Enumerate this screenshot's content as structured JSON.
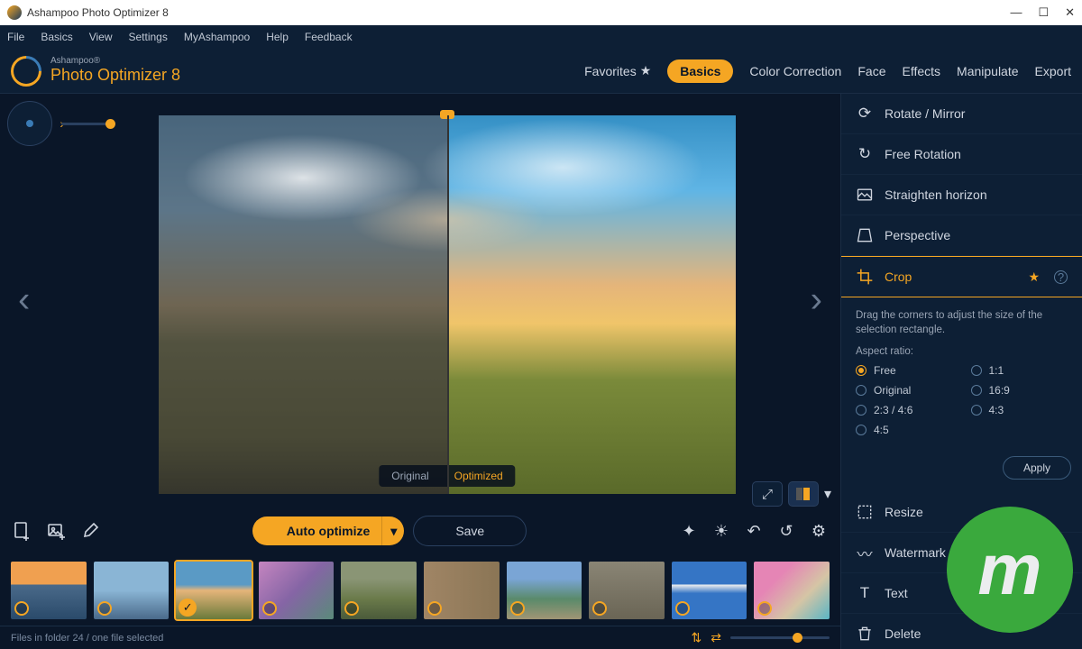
{
  "window": {
    "title": "Ashampoo Photo Optimizer 8"
  },
  "menu": [
    "File",
    "Basics",
    "View",
    "Settings",
    "MyAshampoo",
    "Help",
    "Feedback"
  ],
  "brand": {
    "top": "Ashampoo®",
    "name": "Photo Optimizer 8"
  },
  "tabs": {
    "favorites": "Favorites",
    "items": [
      "Basics",
      "Color Correction",
      "Face",
      "Effects",
      "Manipulate",
      "Export"
    ],
    "active": "Basics"
  },
  "compare": {
    "original": "Original",
    "optimized": "Optimized"
  },
  "toolbar": {
    "auto": "Auto optimize",
    "save": "Save"
  },
  "sidebar": {
    "items": [
      {
        "label": "Rotate / Mirror"
      },
      {
        "label": "Free Rotation"
      },
      {
        "label": "Straighten horizon"
      },
      {
        "label": "Perspective"
      },
      {
        "label": "Crop",
        "active": true
      },
      {
        "label": "Resize"
      },
      {
        "label": "Watermark"
      },
      {
        "label": "Text"
      },
      {
        "label": "Delete"
      }
    ],
    "crop": {
      "help": "Drag the corners to adjust the size of the selection rectangle.",
      "aspect_label": "Aspect ratio:",
      "options": [
        "Free",
        "1:1",
        "Original",
        "16:9",
        "2:3 / 4:6",
        "4:3",
        "4:5"
      ],
      "selected": "Free",
      "apply": "Apply"
    }
  },
  "status": {
    "text": "Files in folder 24 / one file selected",
    "folder_count": 24
  }
}
